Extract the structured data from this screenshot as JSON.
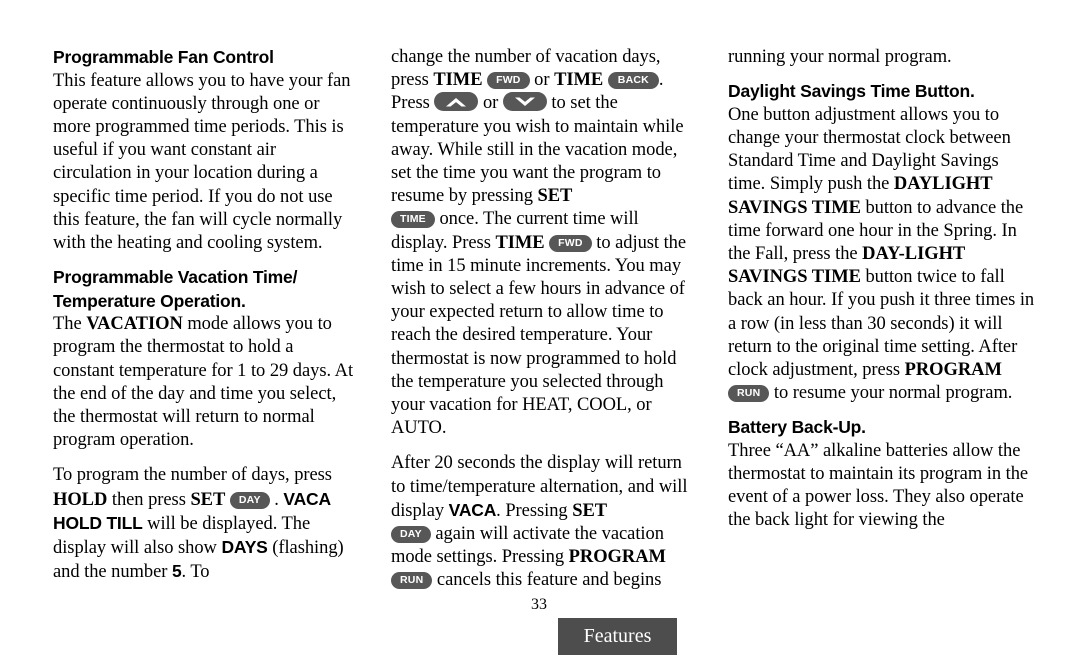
{
  "document": {
    "page_number": "33",
    "footer_tab_label": "Features",
    "colors": {
      "pill_background": "#575757",
      "footer_tab_background": "#4d4d4d",
      "text": "#000000",
      "page_background": "#ffffff"
    }
  },
  "columns": {
    "left": {
      "section_1": {
        "heading": "Programmable Fan Control",
        "paragraph": "This feature allows you to have your fan operate continuously through one or more programmed time periods. This is useful if you want constant air circulation in your location during a specific time period. If you do not use this feature, the fan will cycle normally with the heating and cooling system."
      },
      "section_2": {
        "heading_line_1": "Programmable Vacation Time/",
        "heading_line_2": "Temperature Operation.",
        "paragraph_1": {
          "t1": "The ",
          "b1": "VACATION",
          "t2": " mode allows you to program the thermostat to hold a constant temperature for 1 to 29 days. At the end of the day and time you select, the thermostat will return to normal program operation."
        },
        "paragraph_2": {
          "t1": "To program the number of days, press ",
          "b1": "HOLD",
          "t2": " then press ",
          "b2": "SET",
          "pill_day": "DAY",
          "t3": " . ",
          "b3": "VACA HOLD TILL",
          "t4": " will be displayed. The display will also show ",
          "b4": "DAYS",
          "t5": " (flashing) and the number ",
          "b5": "5",
          "t6": ". To"
        }
      }
    },
    "middle": {
      "paragraph_1": {
        "t1": "change the number of vacation days, press ",
        "b1": "TIME",
        "pill_fwd": "FWD",
        "t2": " or ",
        "b2": "TIME",
        "pill_back": "BACK",
        "t3": ". Press ",
        "arrow_up": "chevron-up",
        "t4": " or ",
        "arrow_down": "chevron-down",
        "t5": " to set the temperature you wish to maintain while away. While still in the vacation mode, set the time you want the program to resume by pressing ",
        "b3": "SET",
        "pill_time": "TIME",
        "t6": " once. The current time will display. Press ",
        "b4": "TIME",
        "pill_fwd_2": "FWD",
        "t7": " to adjust the time in 15 minute increments. You may wish to select a few hours in advance of your expected return to allow time to reach the desired temperature. Your thermostat is now programmed to hold the temperature you selected through your vacation for HEAT, COOL, or AUTO."
      },
      "paragraph_2": {
        "t1": " After 20 seconds the display will return to time/temperature alternation, and will display ",
        "b1": "VACA",
        "t2": ". Pressing ",
        "b2": "SET",
        "pill_day": "DAY",
        "t3": " again will activate the vacation mode settings. Pressing ",
        "b3": "PROGRAM",
        "pill_run": "RUN",
        "t4": " cancels this feature and begins"
      }
    },
    "right": {
      "paragraph_0": "running your normal program.",
      "section_1": {
        "heading": "Daylight Savings Time Button.",
        "paragraph": {
          "t1": "One button adjustment allows you to change your thermostat clock between Standard Time and Daylight Savings time. Simply push the ",
          "b1": "DAYLIGHT SAVINGS TIME",
          "t2": " button to advance the time forward one hour in the Spring. In the Fall, press the ",
          "b2": "DAY-LIGHT SAVINGS TIME",
          "t3": " button twice to fall back an hour. If you push it three times in a row (in less than 30 seconds) it will return to the original time setting. After clock adjustment, press ",
          "b3": "PROGRAM",
          "pill_run": "RUN",
          "t4": " to resume your normal program."
        }
      },
      "section_2": {
        "heading": "Battery Back-Up.",
        "paragraph": "Three “AA” alkaline batteries allow the thermostat to maintain its program in the event of a power loss. They also operate the back light for viewing the"
      }
    }
  }
}
